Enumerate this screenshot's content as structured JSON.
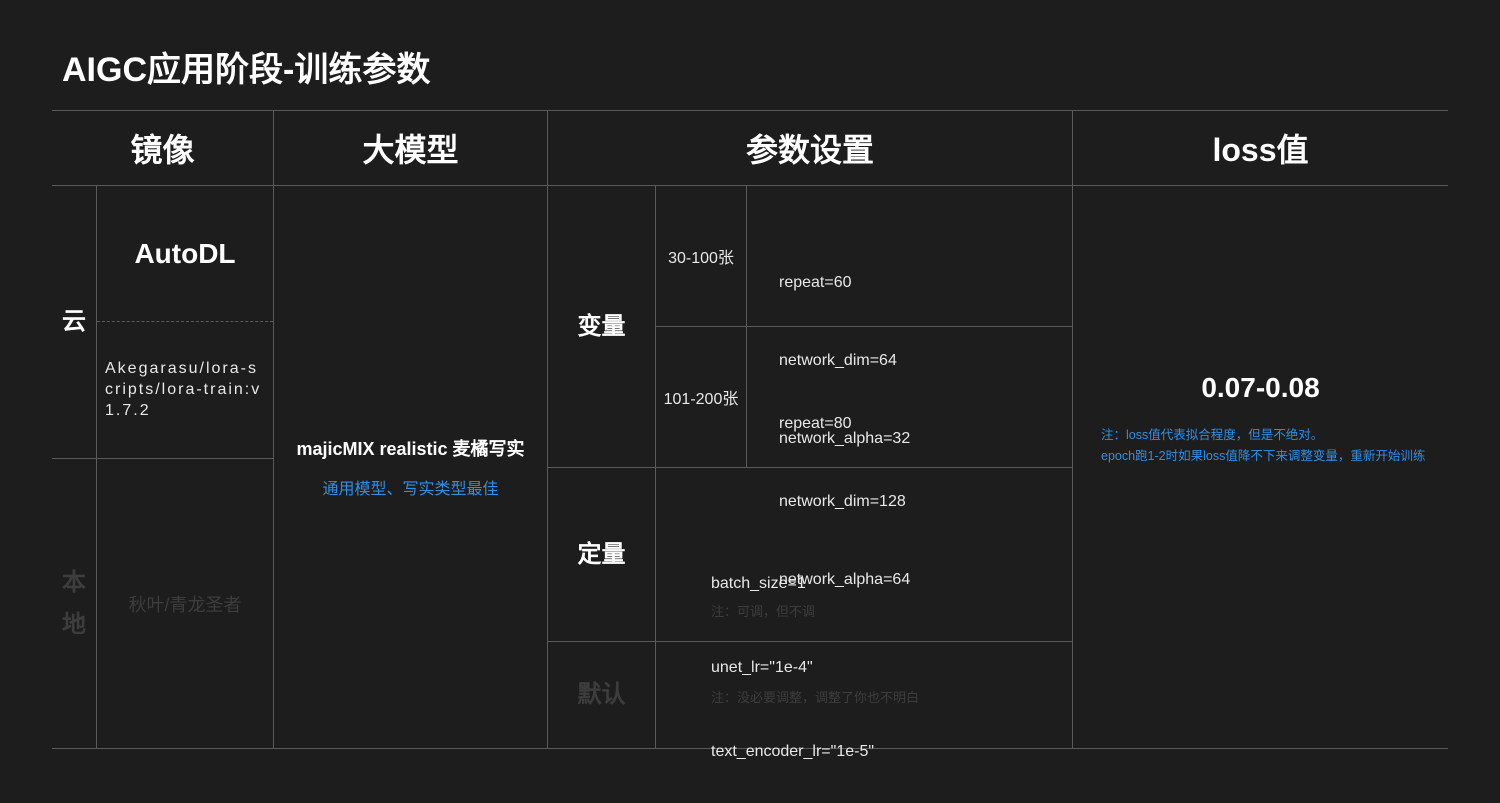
{
  "title": "AIGC应用阶段-训练参数",
  "headers": {
    "image": "镜像",
    "model": "大模型",
    "params": "参数设置",
    "loss": "loss值"
  },
  "mirror": {
    "cloud_label": "云",
    "local_label": "本地",
    "autodl": "AutoDL",
    "lora_scripts": "Akegarasu/lora-scripts/lora-train:v1.7.2",
    "local_name": "秋叶/青龙圣者"
  },
  "model": {
    "name": "majicMIX realistic 麦橘写实",
    "note": "通用模型、写实类型最佳"
  },
  "params": {
    "variable_label": "变量",
    "fixed_label": "定量",
    "default_label": "默认",
    "row1_count": "30-100张",
    "row1_lines": [
      "repeat=60",
      "network_dim=64",
      "network_alpha=32"
    ],
    "row2_count": "101-200张",
    "row2_lines": [
      "repeat=80",
      "network_dim=128",
      "network_alpha=64"
    ],
    "fixed_lines": [
      "batch_size=1",
      "unet_lr=\"1e-4\"",
      "text_encoder_lr=\"1e-5\""
    ],
    "fixed_note": "注：可调，但不调",
    "default_note": "注：没必要调整，调整了你也不明白"
  },
  "loss": {
    "value": "0.07-0.08",
    "note1": "注：loss值代表拟合程度，但是不绝对。",
    "note2": "epoch跑1-2时如果loss值降不下来调整变量，重新开始训练"
  }
}
